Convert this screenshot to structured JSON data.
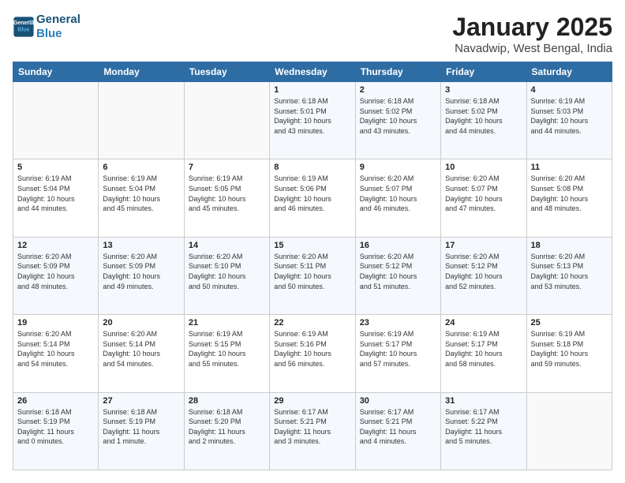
{
  "logo": {
    "line1": "General",
    "line2": "Blue"
  },
  "title": "January 2025",
  "subtitle": "Navadwip, West Bengal, India",
  "header_days": [
    "Sunday",
    "Monday",
    "Tuesday",
    "Wednesday",
    "Thursday",
    "Friday",
    "Saturday"
  ],
  "weeks": [
    [
      {
        "day": "",
        "info": ""
      },
      {
        "day": "",
        "info": ""
      },
      {
        "day": "",
        "info": ""
      },
      {
        "day": "1",
        "info": "Sunrise: 6:18 AM\nSunset: 5:01 PM\nDaylight: 10 hours\nand 43 minutes."
      },
      {
        "day": "2",
        "info": "Sunrise: 6:18 AM\nSunset: 5:02 PM\nDaylight: 10 hours\nand 43 minutes."
      },
      {
        "day": "3",
        "info": "Sunrise: 6:18 AM\nSunset: 5:02 PM\nDaylight: 10 hours\nand 44 minutes."
      },
      {
        "day": "4",
        "info": "Sunrise: 6:19 AM\nSunset: 5:03 PM\nDaylight: 10 hours\nand 44 minutes."
      }
    ],
    [
      {
        "day": "5",
        "info": "Sunrise: 6:19 AM\nSunset: 5:04 PM\nDaylight: 10 hours\nand 44 minutes."
      },
      {
        "day": "6",
        "info": "Sunrise: 6:19 AM\nSunset: 5:04 PM\nDaylight: 10 hours\nand 45 minutes."
      },
      {
        "day": "7",
        "info": "Sunrise: 6:19 AM\nSunset: 5:05 PM\nDaylight: 10 hours\nand 45 minutes."
      },
      {
        "day": "8",
        "info": "Sunrise: 6:19 AM\nSunset: 5:06 PM\nDaylight: 10 hours\nand 46 minutes."
      },
      {
        "day": "9",
        "info": "Sunrise: 6:20 AM\nSunset: 5:07 PM\nDaylight: 10 hours\nand 46 minutes."
      },
      {
        "day": "10",
        "info": "Sunrise: 6:20 AM\nSunset: 5:07 PM\nDaylight: 10 hours\nand 47 minutes."
      },
      {
        "day": "11",
        "info": "Sunrise: 6:20 AM\nSunset: 5:08 PM\nDaylight: 10 hours\nand 48 minutes."
      }
    ],
    [
      {
        "day": "12",
        "info": "Sunrise: 6:20 AM\nSunset: 5:09 PM\nDaylight: 10 hours\nand 48 minutes."
      },
      {
        "day": "13",
        "info": "Sunrise: 6:20 AM\nSunset: 5:09 PM\nDaylight: 10 hours\nand 49 minutes."
      },
      {
        "day": "14",
        "info": "Sunrise: 6:20 AM\nSunset: 5:10 PM\nDaylight: 10 hours\nand 50 minutes."
      },
      {
        "day": "15",
        "info": "Sunrise: 6:20 AM\nSunset: 5:11 PM\nDaylight: 10 hours\nand 50 minutes."
      },
      {
        "day": "16",
        "info": "Sunrise: 6:20 AM\nSunset: 5:12 PM\nDaylight: 10 hours\nand 51 minutes."
      },
      {
        "day": "17",
        "info": "Sunrise: 6:20 AM\nSunset: 5:12 PM\nDaylight: 10 hours\nand 52 minutes."
      },
      {
        "day": "18",
        "info": "Sunrise: 6:20 AM\nSunset: 5:13 PM\nDaylight: 10 hours\nand 53 minutes."
      }
    ],
    [
      {
        "day": "19",
        "info": "Sunrise: 6:20 AM\nSunset: 5:14 PM\nDaylight: 10 hours\nand 54 minutes."
      },
      {
        "day": "20",
        "info": "Sunrise: 6:20 AM\nSunset: 5:14 PM\nDaylight: 10 hours\nand 54 minutes."
      },
      {
        "day": "21",
        "info": "Sunrise: 6:19 AM\nSunset: 5:15 PM\nDaylight: 10 hours\nand 55 minutes."
      },
      {
        "day": "22",
        "info": "Sunrise: 6:19 AM\nSunset: 5:16 PM\nDaylight: 10 hours\nand 56 minutes."
      },
      {
        "day": "23",
        "info": "Sunrise: 6:19 AM\nSunset: 5:17 PM\nDaylight: 10 hours\nand 57 minutes."
      },
      {
        "day": "24",
        "info": "Sunrise: 6:19 AM\nSunset: 5:17 PM\nDaylight: 10 hours\nand 58 minutes."
      },
      {
        "day": "25",
        "info": "Sunrise: 6:19 AM\nSunset: 5:18 PM\nDaylight: 10 hours\nand 59 minutes."
      }
    ],
    [
      {
        "day": "26",
        "info": "Sunrise: 6:18 AM\nSunset: 5:19 PM\nDaylight: 11 hours\nand 0 minutes."
      },
      {
        "day": "27",
        "info": "Sunrise: 6:18 AM\nSunset: 5:19 PM\nDaylight: 11 hours\nand 1 minute."
      },
      {
        "day": "28",
        "info": "Sunrise: 6:18 AM\nSunset: 5:20 PM\nDaylight: 11 hours\nand 2 minutes."
      },
      {
        "day": "29",
        "info": "Sunrise: 6:17 AM\nSunset: 5:21 PM\nDaylight: 11 hours\nand 3 minutes."
      },
      {
        "day": "30",
        "info": "Sunrise: 6:17 AM\nSunset: 5:21 PM\nDaylight: 11 hours\nand 4 minutes."
      },
      {
        "day": "31",
        "info": "Sunrise: 6:17 AM\nSunset: 5:22 PM\nDaylight: 11 hours\nand 5 minutes."
      },
      {
        "day": "",
        "info": ""
      }
    ]
  ]
}
